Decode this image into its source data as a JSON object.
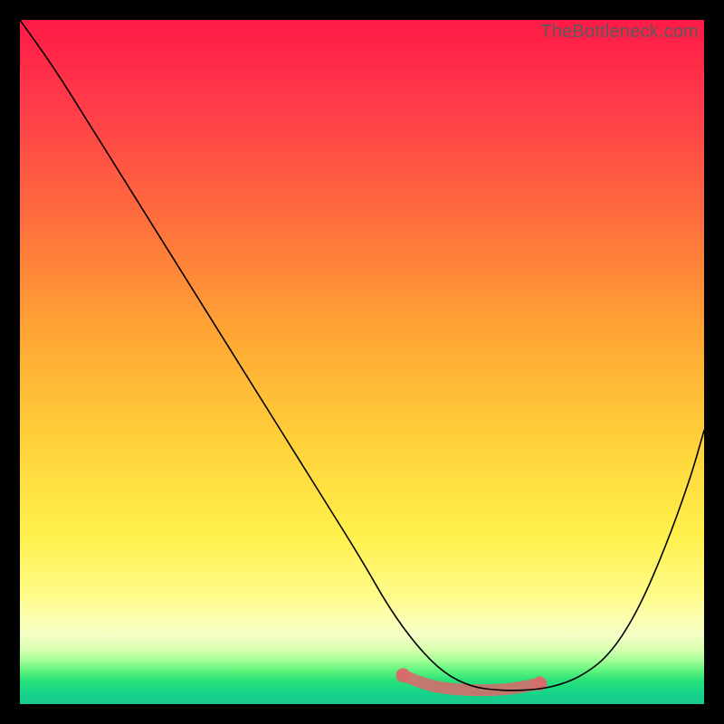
{
  "watermark": "TheBottleneck.com",
  "chart_data": {
    "type": "line",
    "title": "",
    "xlabel": "",
    "ylabel": "",
    "xlim": [
      0,
      100
    ],
    "ylim": [
      0,
      100
    ],
    "series": [
      {
        "name": "bottleneck-curve",
        "x": [
          0,
          5,
          10,
          15,
          20,
          25,
          30,
          35,
          40,
          45,
          50,
          54,
          58,
          62,
          66,
          70,
          74,
          78,
          82,
          86,
          90,
          94,
          98,
          100
        ],
        "y": [
          100,
          93,
          85,
          77,
          69,
          61,
          53,
          45,
          37,
          29,
          21,
          14,
          8.5,
          4.5,
          2.5,
          2,
          2,
          2.5,
          4,
          7,
          13,
          22,
          33,
          40
        ]
      },
      {
        "name": "sweet-spot-underline",
        "x": [
          56,
          60,
          64,
          68,
          72,
          76
        ],
        "y": [
          4.2,
          2.6,
          2.1,
          2.0,
          2.2,
          3.0
        ]
      }
    ],
    "annotations": [
      {
        "name": "sweet-spot-dot-left",
        "x": 56,
        "y": 4.2
      },
      {
        "name": "sweet-spot-dot-right",
        "x": 76,
        "y": 3.0
      }
    ],
    "gradient_stops": [
      {
        "pos": 0.0,
        "color": "#ff1a47"
      },
      {
        "pos": 0.45,
        "color": "#ffa334"
      },
      {
        "pos": 0.75,
        "color": "#fff04a"
      },
      {
        "pos": 0.92,
        "color": "#d7ffb0"
      },
      {
        "pos": 1.0,
        "color": "#1cc98a"
      }
    ]
  }
}
